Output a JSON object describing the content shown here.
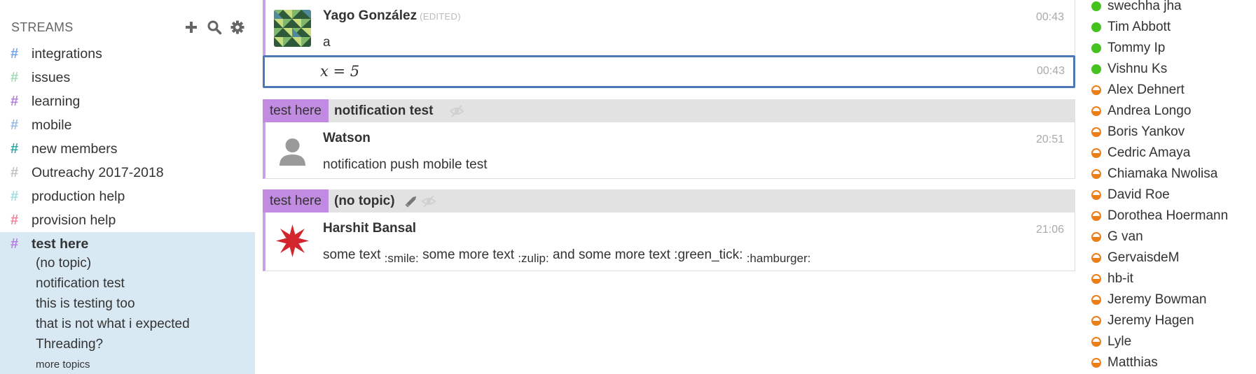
{
  "left_sidebar": {
    "header": "STREAMS",
    "streams": [
      {
        "name": "integrations",
        "color": "#76a6e5"
      },
      {
        "name": "issues",
        "color": "#a3dbb7"
      },
      {
        "name": "learning",
        "color": "#b380e0"
      },
      {
        "name": "mobile",
        "color": "#9abbe6"
      },
      {
        "name": "new members",
        "color": "#34a5a8"
      },
      {
        "name": "Outreachy 2017-2018",
        "color": "#c2c2c2"
      },
      {
        "name": "production help",
        "color": "#9ee0e0"
      },
      {
        "name": "provision help",
        "color": "#f0859e"
      },
      {
        "name": "test here",
        "color": "#b380e0"
      }
    ],
    "topics": [
      "(no topic)",
      "notification test",
      "this is testing too",
      "that is not what i expected",
      "Threading?"
    ],
    "more_topics": "more topics"
  },
  "messages": {
    "first": {
      "sender": "Yago González",
      "edited": "(EDITED)",
      "time": "00:43",
      "content": "a"
    },
    "second": {
      "math": "x = 5",
      "time": "00:43"
    },
    "group1": {
      "stream": "test here",
      "topic": "notification test",
      "sender": "Watson",
      "time": "20:51",
      "content": "notification push mobile test"
    },
    "group2": {
      "stream": "test here",
      "topic": "(no topic)",
      "sender": "Harshit Bansal",
      "time": "21:06",
      "parts": [
        "some text",
        ":smile:",
        "some more text",
        ":zulip:",
        "and some more text :green_tick:",
        ":hamburger:"
      ]
    }
  },
  "right_sidebar": {
    "users": [
      {
        "name": "swechha jha",
        "status": "active"
      },
      {
        "name": "Tim Abbott",
        "status": "active"
      },
      {
        "name": "Tommy Ip",
        "status": "active"
      },
      {
        "name": "Vishnu Ks",
        "status": "active"
      },
      {
        "name": "Alex Dehnert",
        "status": "idle"
      },
      {
        "name": "Andrea Longo",
        "status": "idle"
      },
      {
        "name": "Boris Yankov",
        "status": "idle"
      },
      {
        "name": "Cedric Amaya",
        "status": "idle"
      },
      {
        "name": "Chiamaka Nwolisa",
        "status": "idle"
      },
      {
        "name": "David Roe",
        "status": "idle"
      },
      {
        "name": "Dorothea Hoermann",
        "status": "idle"
      },
      {
        "name": "G van",
        "status": "idle"
      },
      {
        "name": "GervaisdeM",
        "status": "idle"
      },
      {
        "name": "hb-it",
        "status": "idle"
      },
      {
        "name": "Jeremy Bowman",
        "status": "idle"
      },
      {
        "name": "Jeremy Hagen",
        "status": "idle"
      },
      {
        "name": "Lyle",
        "status": "idle"
      },
      {
        "name": "Matthias",
        "status": "idle"
      }
    ]
  },
  "colors": {
    "stream_bar": "#c08be0",
    "selected_border": "#4c79b5",
    "active_highlight": "#d9e9f4",
    "presence_active": "#44c21d",
    "presence_idle": "#ec7e18"
  },
  "icons": {
    "add": "plus-icon",
    "search": "search-icon",
    "settings": "gear-icon",
    "edit": "pencil-icon",
    "mute": "eye-slash-icon"
  }
}
